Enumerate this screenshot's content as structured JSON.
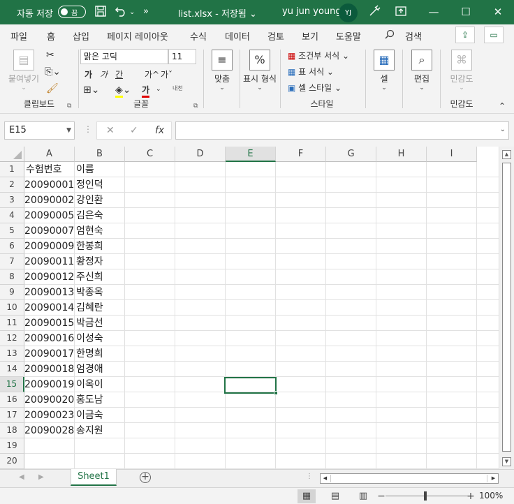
{
  "titlebar": {
    "autosave_label": "자동 저장",
    "autosave_state": "끔",
    "filename": "list.xlsx  -  저장됨  ⌄",
    "user": "yu jun young",
    "avatar_initials": "YJ"
  },
  "tabs": [
    "파일",
    "홈",
    "삽입",
    "페이지 레이아웃",
    "수식",
    "데이터",
    "검토",
    "보기",
    "도움말"
  ],
  "active_tab": "홈",
  "search_label": "검색",
  "ribbon": {
    "paste_label": "붙여넣기",
    "clipboard_group": "클립보드",
    "font_name": "맑은 고딕",
    "font_size": "11",
    "font_group": "글꼴",
    "align_label": "맞춤",
    "number_label": "표시 형식",
    "conditional_label": "조건부 서식",
    "table_label": "표 서식",
    "cellstyle_label": "셀 스타일",
    "style_group": "스타일",
    "cells_label": "셀",
    "edit_label": "편집",
    "sensitivity_label": "민감도",
    "sensitivity_group": "민감도",
    "bold_glyph": "가",
    "italic_glyph": "가",
    "underline_glyph": "간",
    "grow_glyph": "가^",
    "shrink_glyph": "가ˇ",
    "fontcolor_glyph": "가",
    "phonetic_glyph": "내천"
  },
  "formula": {
    "namebox": "E15",
    "cancel_glyph": "✕",
    "enter_glyph": "✓",
    "fx_glyph": "fx",
    "value": ""
  },
  "columns": [
    "A",
    "B",
    "C",
    "D",
    "E",
    "F",
    "G",
    "H",
    "I"
  ],
  "selected_column": "E",
  "selected_row": "15",
  "rows": [
    {
      "n": "1",
      "a": "수험번호",
      "b": "이름"
    },
    {
      "n": "2",
      "a": "20090001",
      "b": "정인덕"
    },
    {
      "n": "3",
      "a": "20090002",
      "b": "강인환"
    },
    {
      "n": "4",
      "a": "20090005",
      "b": "김은숙"
    },
    {
      "n": "5",
      "a": "20090007",
      "b": "엄현숙"
    },
    {
      "n": "6",
      "a": "20090009",
      "b": "한봉희"
    },
    {
      "n": "7",
      "a": "20090011",
      "b": "황정자"
    },
    {
      "n": "8",
      "a": "20090012",
      "b": "주신희"
    },
    {
      "n": "9",
      "a": "20090013",
      "b": "박종옥"
    },
    {
      "n": "10",
      "a": "20090014",
      "b": "김혜란"
    },
    {
      "n": "11",
      "a": "20090015",
      "b": "박금선"
    },
    {
      "n": "12",
      "a": "20090016",
      "b": "이성숙"
    },
    {
      "n": "13",
      "a": "20090017",
      "b": "한명희"
    },
    {
      "n": "14",
      "a": "20090018",
      "b": "엄경애"
    },
    {
      "n": "15",
      "a": "20090019",
      "b": "이옥이"
    },
    {
      "n": "16",
      "a": "20090020",
      "b": "홍도남"
    },
    {
      "n": "17",
      "a": "20090023",
      "b": "이금숙"
    },
    {
      "n": "18",
      "a": "20090028",
      "b": "송지원"
    },
    {
      "n": "19",
      "a": "",
      "b": ""
    },
    {
      "n": "20",
      "a": "",
      "b": ""
    }
  ],
  "sheet_tab": "Sheet1",
  "zoom": "100%",
  "colors": {
    "accent": "#217346"
  }
}
